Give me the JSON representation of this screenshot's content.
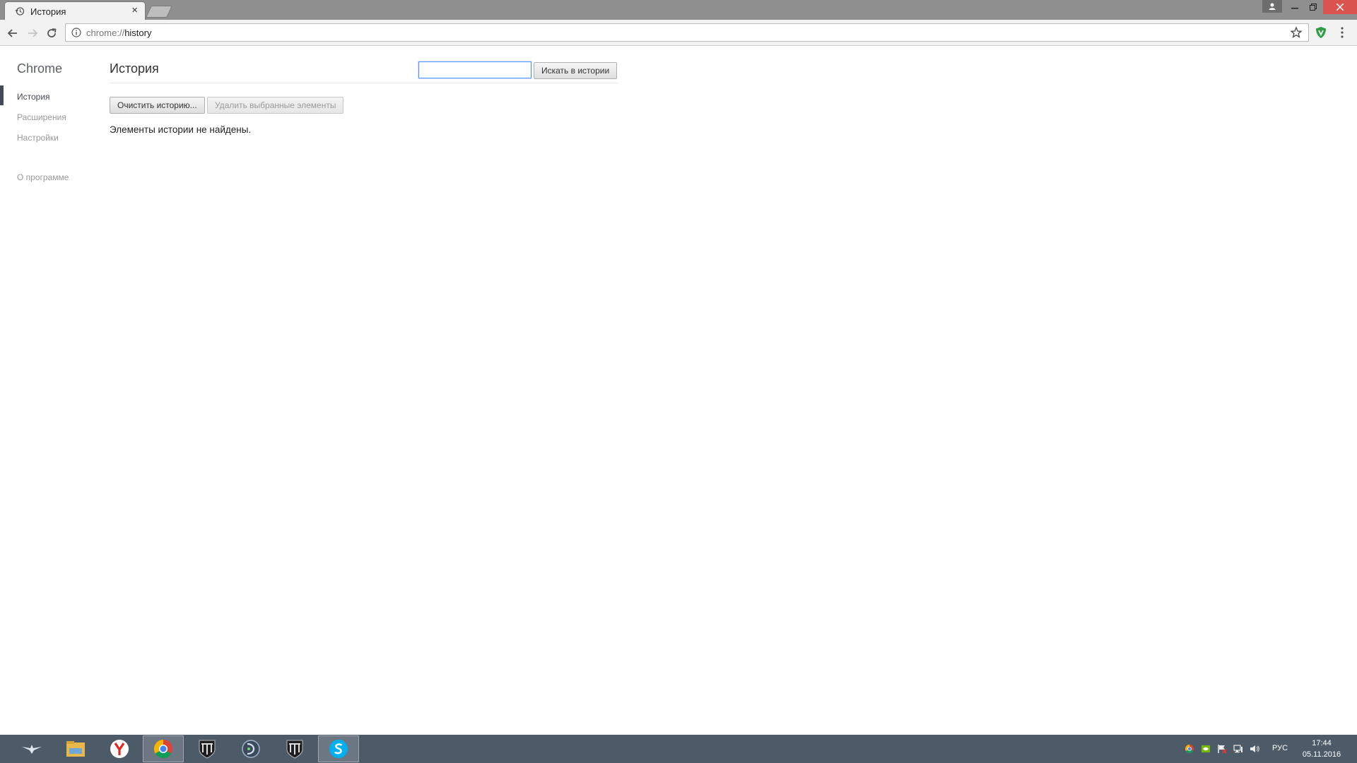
{
  "browser": {
    "tab_title": "История",
    "tab_close": "×",
    "url_scheme": "chrome://",
    "url_host": "history"
  },
  "sidebar": {
    "brand": "Chrome",
    "items": [
      {
        "label": "История",
        "active": true
      },
      {
        "label": "Расширения",
        "active": false
      },
      {
        "label": "Настройки",
        "active": false
      },
      {
        "label": "О программе",
        "active": false
      }
    ]
  },
  "main": {
    "title": "История",
    "search_value": "",
    "search_button": "Искать в истории",
    "clear_button": "Очистить историю...",
    "remove_button": "Удалить выбранные элементы",
    "empty_message": "Элементы истории не найдены."
  },
  "taskbar": {
    "pinned": [
      "start-icon",
      "file-explorer-icon",
      "yandex-browser-icon",
      "chrome-icon",
      "world-of-tanks-icon",
      "game-center-icon",
      "world-of-tanks-icon",
      "skype-icon"
    ],
    "active_index": 3,
    "language": "РУС",
    "time": "17:44",
    "date": "05.11.2016"
  },
  "colors": {
    "accent": "#4d90fe",
    "sidebar_active": "#464a54",
    "taskbar": "#4d5a68",
    "close_button": "#d9534f"
  }
}
